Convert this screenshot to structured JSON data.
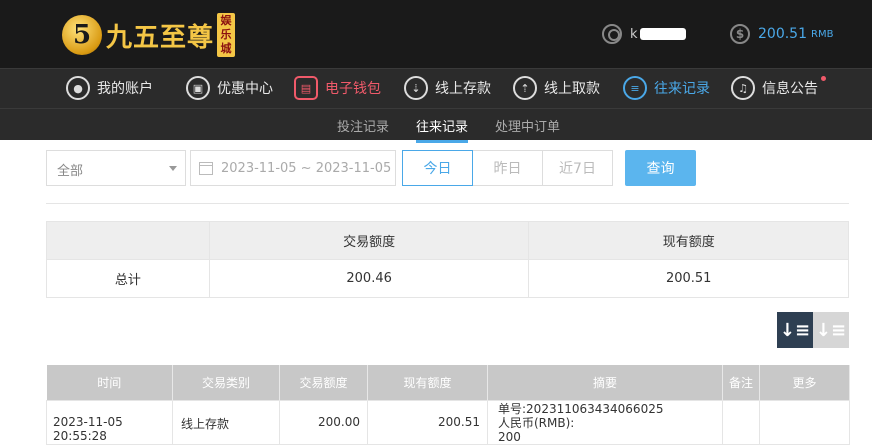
{
  "brand": {
    "mark": "5",
    "name": "九五至尊",
    "tag": "娱乐城"
  },
  "user": {
    "name": "k"
  },
  "balance": {
    "value": "200.51",
    "unit": "RMB",
    "icon": "dollar-icon"
  },
  "nav": {
    "items": [
      {
        "label": "我的账户",
        "icon": "user-icon"
      },
      {
        "label": "优惠中心",
        "icon": "gift-icon"
      },
      {
        "label": "电子钱包",
        "icon": "wallet-icon"
      },
      {
        "label": "线上存款",
        "icon": "deposit-icon"
      },
      {
        "label": "线上取款",
        "icon": "withdraw-icon"
      },
      {
        "label": "往来记录",
        "icon": "records-icon"
      },
      {
        "label": "信息公告",
        "icon": "bell-icon"
      }
    ]
  },
  "subnav": {
    "items": [
      "投注记录",
      "往来记录",
      "处理中订单"
    ]
  },
  "filters": {
    "type": "全部",
    "date_range": "2023-11-05 ~ 2023-11-05",
    "days": [
      "今日",
      "昨日",
      "近7日"
    ],
    "query": "查询"
  },
  "summary": {
    "headers": [
      "",
      "交易额度",
      "现有额度"
    ],
    "row": [
      "总计",
      "200.46",
      "200.51"
    ]
  },
  "records": {
    "headers": [
      "时间",
      "交易类别",
      "交易额度",
      "现有额度",
      "摘要",
      "备注",
      "更多"
    ],
    "rows": [
      {
        "time": "2023-11-05 20:55:28",
        "category": "线上存款",
        "amount": "200.00",
        "balance": "200.51",
        "summary_line1": "单号:202311063434066025",
        "summary_line2": "人民币(RMB):",
        "summary_line3": "200",
        "note": "",
        "more": ""
      }
    ]
  }
}
